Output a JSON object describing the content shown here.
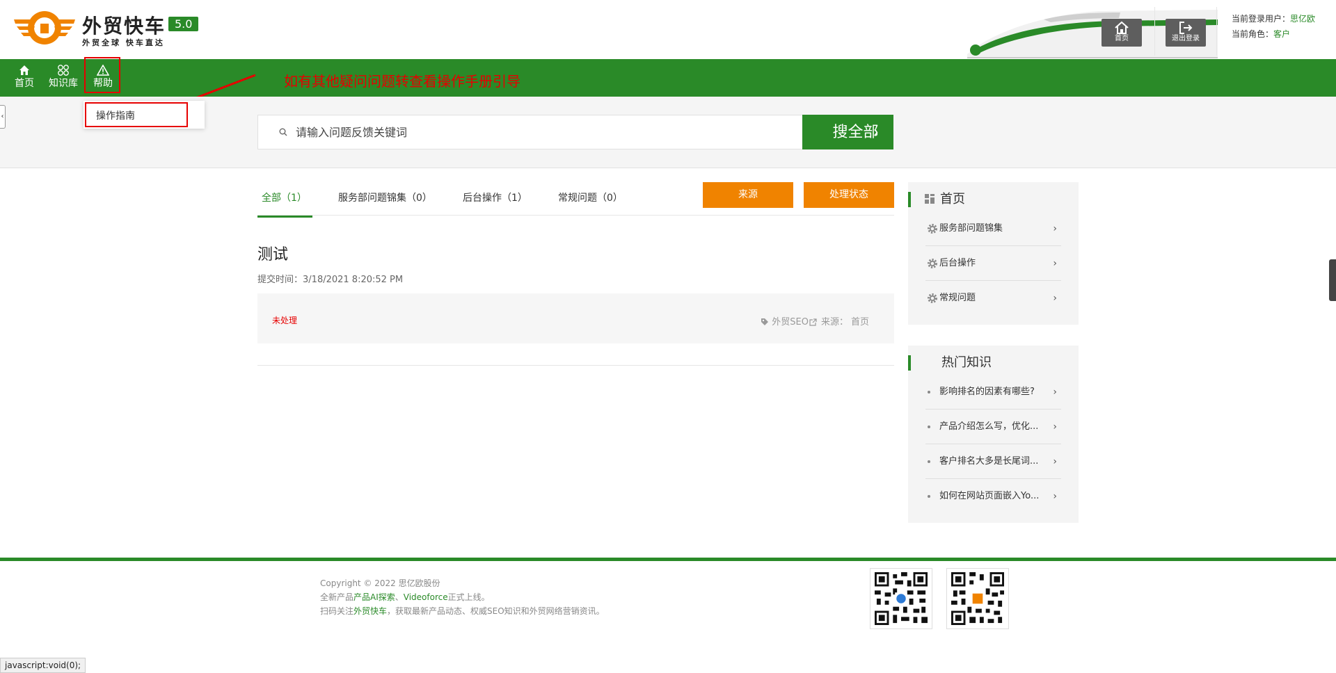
{
  "header": {
    "brand_name": "外贸快车",
    "brand_slogan": "外贸全球 快车直达",
    "version": "5.0",
    "home_button_label": "首页",
    "logout_button_label": "退出登录",
    "user_label": "当前登录用户：",
    "user_value": "思亿欧",
    "role_label": "当前角色：",
    "role_value": "客户"
  },
  "nav": {
    "items": [
      {
        "label": "首页",
        "icon": "home-icon"
      },
      {
        "label": "知识库",
        "icon": "knowledge-icon"
      },
      {
        "label": "帮助",
        "icon": "warning-icon"
      }
    ],
    "notice": "如有其他疑问问题转查看操作手册引导"
  },
  "dropdown": {
    "item_label": "操作指南"
  },
  "search": {
    "placeholder": "请输入问题反馈关键词",
    "button_label": "搜全部"
  },
  "tabs": [
    {
      "label": "全部（1）",
      "active": true
    },
    {
      "label": "服务部问题锦集（0）",
      "active": false
    },
    {
      "label": "后台操作（1）",
      "active": false
    },
    {
      "label": "常规问题（0）",
      "active": false
    }
  ],
  "filters": {
    "source_label": "来源",
    "status_label": "处理状态"
  },
  "post": {
    "title": "测试",
    "submit_time_label": "提交时间：",
    "submit_time": "3/18/2021 8:20:52 PM",
    "status": "未处理",
    "tag": "外贸SEO",
    "source_label": "来源：",
    "source_value": "首页"
  },
  "sidebar": {
    "category_title": "首页",
    "categories": [
      "服务部问题锦集",
      "后台操作",
      "常规问题"
    ],
    "hot_title": "热门知识",
    "hot_items": [
      "影响排名的因素有哪些?",
      "产品介绍怎么写，优化...",
      "客户排名大多是长尾词...",
      "如何在网站页面嵌入Yo..."
    ]
  },
  "footer": {
    "copyright": "Copyright © 2022 思亿欧股份",
    "line2_prefix": "全新产品",
    "line2_link1": "产品AI探索",
    "line2_sep": "、",
    "line2_link2": "Videoforce",
    "line2_suffix": "正式上线。",
    "line3_prefix": "扫码关注",
    "line3_link": "外贸快车",
    "line3_suffix": "，获取最新产品动态、权威SEO知识和外贸网络营销资讯。"
  },
  "statusbar": {
    "text": "javascript:void(0);"
  },
  "colors": {
    "brand_green": "#2a8a28",
    "accent_orange": "#f08300",
    "alert_red": "#e60000"
  }
}
